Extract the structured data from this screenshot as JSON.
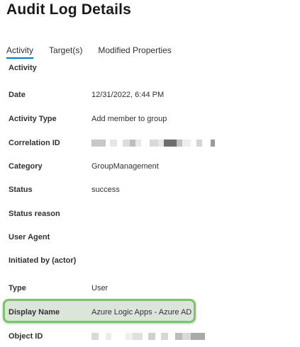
{
  "page": {
    "title": "Audit Log Details"
  },
  "tabs": [
    {
      "label": "Activity",
      "selected": true
    },
    {
      "label": "Target(s)",
      "selected": false
    },
    {
      "label": "Modified Properties",
      "selected": false
    }
  ],
  "activity": {
    "heading": "Activity",
    "rows": [
      {
        "label": "Date",
        "value": "12/31/2022, 6:44 PM"
      },
      {
        "label": "Activity Type",
        "value": "Add member to group"
      },
      {
        "label": "Correlation ID",
        "value": ""
      },
      {
        "label": "Category",
        "value": "GroupManagement"
      },
      {
        "label": "Status",
        "value": "success"
      },
      {
        "label": "Status reason",
        "value": ""
      },
      {
        "label": "User Agent",
        "value": ""
      }
    ]
  },
  "initiated_by": {
    "heading": "Initiated by (actor)",
    "rows": [
      {
        "label": "Type",
        "value": "User"
      },
      {
        "label": "Display Name",
        "value": "Azure Logic Apps - Azure AD"
      },
      {
        "label": "Object ID",
        "value": ""
      }
    ]
  },
  "colors": {
    "tab_selected_underline": "#0078d4",
    "highlight_border": "#7cc46a",
    "highlight_fill": "#dce5d9"
  }
}
